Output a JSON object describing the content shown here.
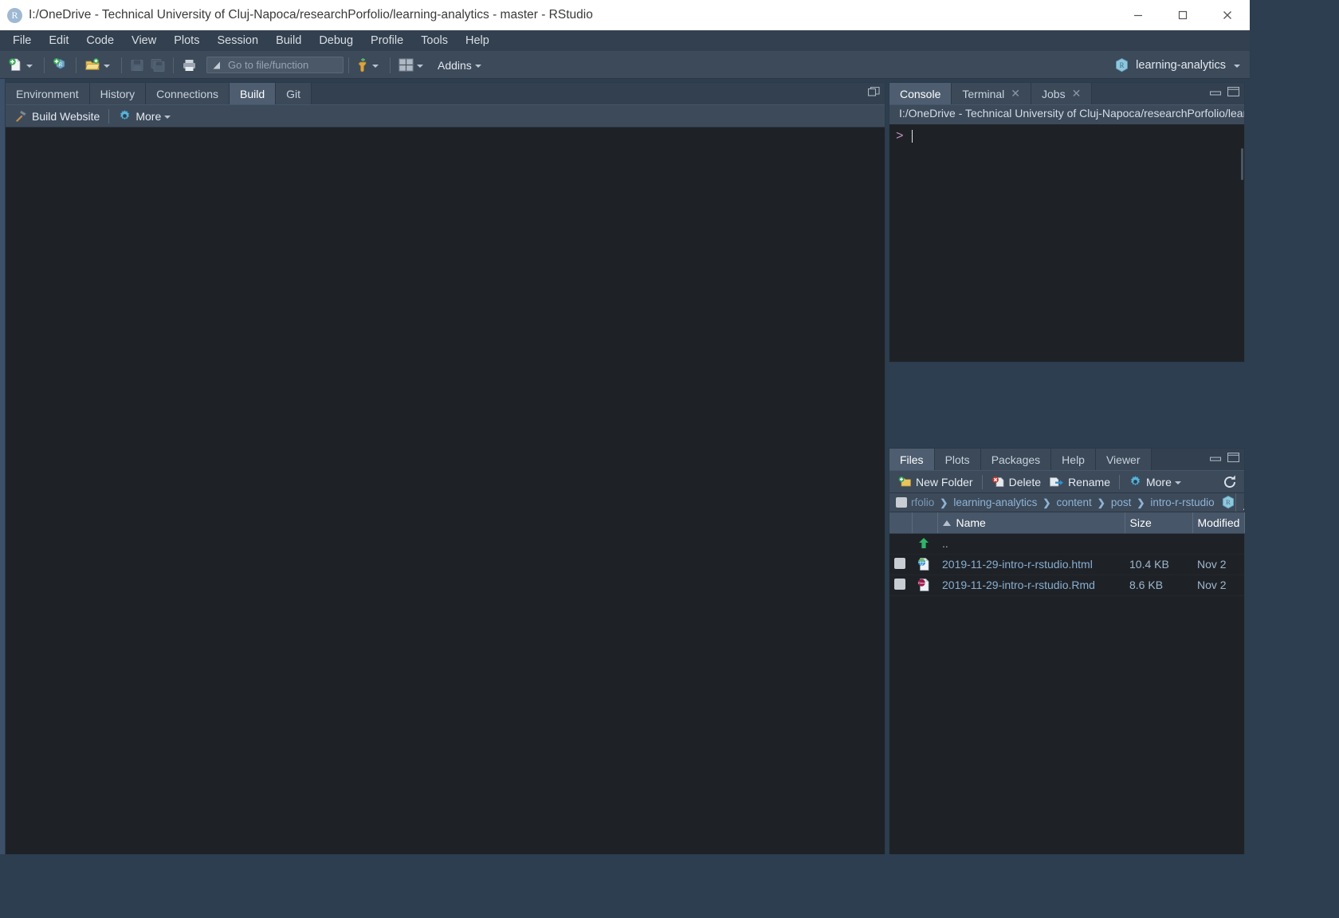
{
  "window": {
    "title": "I:/OneDrive - Technical University of Cluj-Napoca/researchPorfolio/learning-analytics - master - RStudio",
    "logo_letter": "R",
    "minimize_label": "Minimize",
    "maximize_label": "Maximize",
    "close_label": "Close"
  },
  "menubar": {
    "items": [
      {
        "label": "File"
      },
      {
        "label": "Edit"
      },
      {
        "label": "Code"
      },
      {
        "label": "View"
      },
      {
        "label": "Plots"
      },
      {
        "label": "Session"
      },
      {
        "label": "Build"
      },
      {
        "label": "Debug"
      },
      {
        "label": "Profile"
      },
      {
        "label": "Tools"
      },
      {
        "label": "Help"
      }
    ]
  },
  "toolbar": {
    "new_file_label": "New File",
    "new_project_label": "New Project",
    "open_file_label": "Open File",
    "save_label": "Save",
    "save_all_label": "Save All",
    "print_label": "Print",
    "goto_placeholder": "Go to file/function",
    "addins_label": "Addins",
    "project_label": "learning-analytics"
  },
  "build_pane": {
    "tabs": [
      {
        "label": "Environment",
        "active": false
      },
      {
        "label": "History",
        "active": false
      },
      {
        "label": "Connections",
        "active": false
      },
      {
        "label": "Build",
        "active": true
      },
      {
        "label": "Git",
        "active": false
      }
    ],
    "actions": [
      {
        "label": "Build Website",
        "icon": "hammer-icon"
      },
      {
        "label": "More",
        "icon": "gear-icon"
      }
    ],
    "output": ""
  },
  "console_pane": {
    "tabs": [
      {
        "label": "Console",
        "active": true,
        "closable": false
      },
      {
        "label": "Terminal",
        "active": false,
        "closable": true
      },
      {
        "label": "Jobs",
        "active": false,
        "closable": true
      }
    ],
    "path": "I:/OneDrive - Technical University of Cluj-Napoca/researchPorfolio/learning-",
    "prompt": ">",
    "input_value": ""
  },
  "files_pane": {
    "tabs": [
      {
        "label": "Files",
        "active": true
      },
      {
        "label": "Plots",
        "active": false
      },
      {
        "label": "Packages",
        "active": false
      },
      {
        "label": "Help",
        "active": false
      },
      {
        "label": "Viewer",
        "active": false
      }
    ],
    "actions": [
      {
        "label": "New Folder",
        "icon": "new-folder-icon"
      },
      {
        "label": "Delete",
        "icon": "delete-icon"
      },
      {
        "label": "Rename",
        "icon": "rename-icon"
      },
      {
        "label": "More",
        "icon": "gear-icon"
      }
    ],
    "refresh_label": "Refresh",
    "breadcrumbs": [
      "rfolio",
      "learning-analytics",
      "content",
      "post",
      "intro-r-rstudio"
    ],
    "breadcrumb_overflow": "...",
    "columns": [
      "",
      "",
      "Name",
      "Size",
      "Modified"
    ],
    "sort_column": "Name",
    "rows": [
      {
        "name": "..",
        "size": "",
        "modified": "",
        "icon": "up-arrow-icon",
        "checkbox": false
      },
      {
        "name": "2019-11-29-intro-r-rstudio.html",
        "size": "10.4 KB",
        "modified": "Nov 2",
        "icon": "html-file-icon",
        "checkbox": true
      },
      {
        "name": "2019-11-29-intro-r-rstudio.Rmd",
        "size": "8.6 KB",
        "modified": "Nov 2",
        "icon": "rmd-file-icon",
        "checkbox": true
      }
    ]
  },
  "colors": {
    "chrome": "#33404f",
    "toolbar": "#3c4a5a",
    "editor_bg": "#1e2227",
    "active_tab": "#4e5e70",
    "link": "#8aaed0",
    "accent": "#75aadb"
  }
}
